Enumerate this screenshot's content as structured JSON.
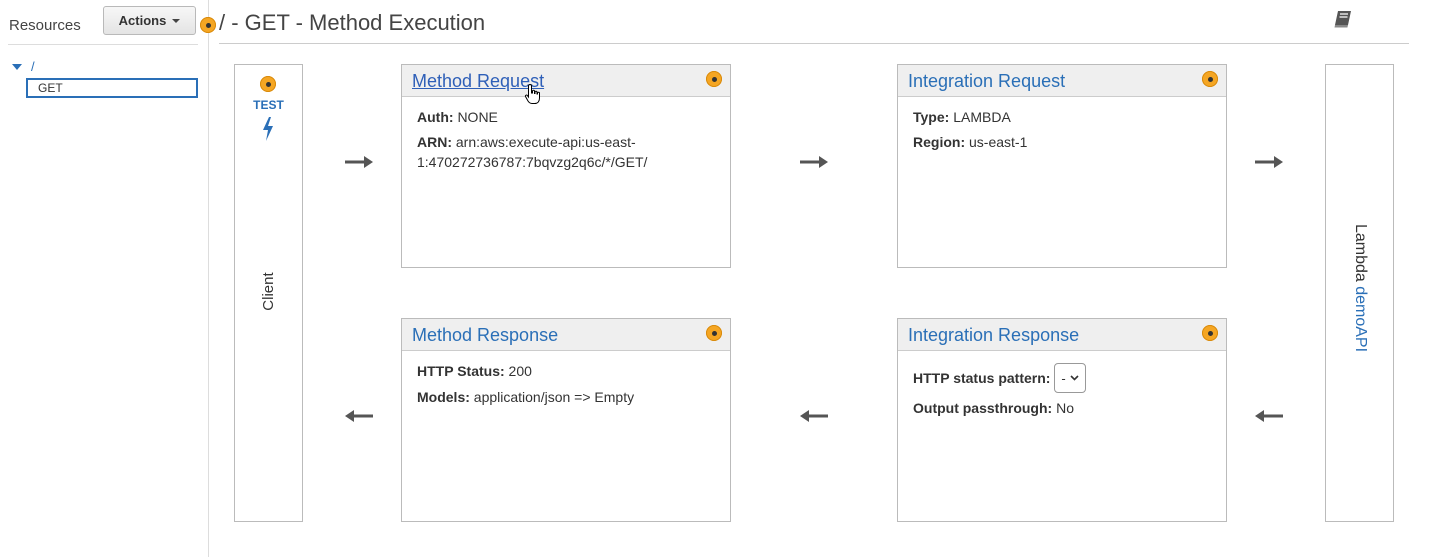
{
  "sidebar": {
    "title": "Resources",
    "actions_label": "Actions",
    "tree_root": "/",
    "tree_selected": "GET"
  },
  "header": {
    "title": "/ - GET - Method Execution"
  },
  "client": {
    "test_label": "TEST",
    "label": "Client"
  },
  "method_request": {
    "title": "Method Request",
    "auth_label": "Auth:",
    "auth_value": "NONE",
    "arn_label": "ARN:",
    "arn_line1": "arn:aws:execute-api:us-east-",
    "arn_line2": "1:470272736787:7bqvzg2q6c/*/GET/"
  },
  "integration_request": {
    "title": "Integration Request",
    "type_label": "Type:",
    "type_value": "LAMBDA",
    "region_label": "Region:",
    "region_value": "us-east-1"
  },
  "method_response": {
    "title": "Method Response",
    "status_label": "HTTP Status:",
    "status_value": "200",
    "models_label": "Models:",
    "models_value": "application/json => Empty"
  },
  "integration_response": {
    "title": "Integration Response",
    "pattern_label": "HTTP status pattern:",
    "pattern_value": "-",
    "passthrough_label": "Output passthrough:",
    "passthrough_value": "No"
  },
  "lambda": {
    "prefix": "Lambda",
    "function_name": "demoAPI"
  },
  "colors": {
    "accent_blue": "#2a6fb7",
    "status_orange": "#f5a623"
  },
  "icons": [
    "orange-status-dot-icon",
    "book-icon",
    "lightning-bolt-icon",
    "arrow-right-icon",
    "arrow-left-icon",
    "caret-down-icon"
  ]
}
